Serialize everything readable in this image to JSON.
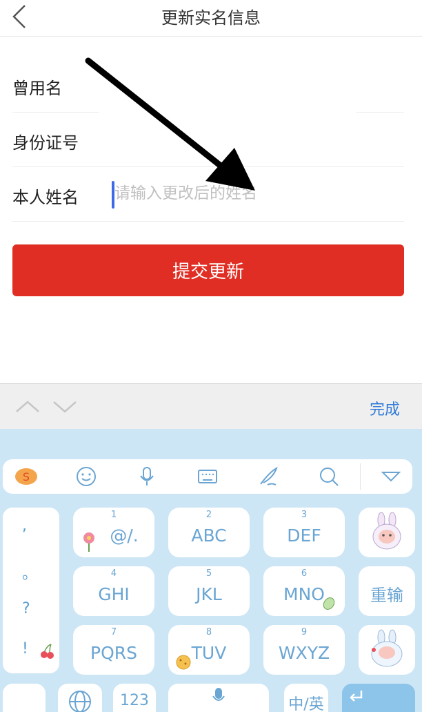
{
  "header": {
    "title": "更新实名信息"
  },
  "form": {
    "rows": [
      {
        "label": "曾用名"
      },
      {
        "label": "身份证号"
      },
      {
        "label": "本人姓名",
        "placeholder": "请输入更改后的姓名"
      }
    ],
    "submit_label": "提交更新"
  },
  "toolbar": {
    "done_label": "完成"
  },
  "keyboard": {
    "punctuation": [
      ",",
      "。",
      "?",
      "!"
    ],
    "keys": [
      {
        "num": "1",
        "letters": "@/."
      },
      {
        "num": "2",
        "letters": "ABC"
      },
      {
        "num": "3",
        "letters": "DEF"
      },
      {
        "num": "4",
        "letters": "GHI"
      },
      {
        "num": "5",
        "letters": "JKL"
      },
      {
        "num": "6",
        "letters": "MNO"
      },
      {
        "num": "7",
        "letters": "PQRS"
      },
      {
        "num": "8",
        "letters": "TUV"
      },
      {
        "num": "9",
        "letters": "WXYZ"
      }
    ],
    "reinput_label": "重输",
    "num_switch_label": "123",
    "lang_switch_label": "中/英"
  },
  "colors": {
    "accent": "#e02e24",
    "link": "#2f7ad8",
    "keyboard_bg": "#cde6f6",
    "key_text": "#6aa5d3"
  }
}
